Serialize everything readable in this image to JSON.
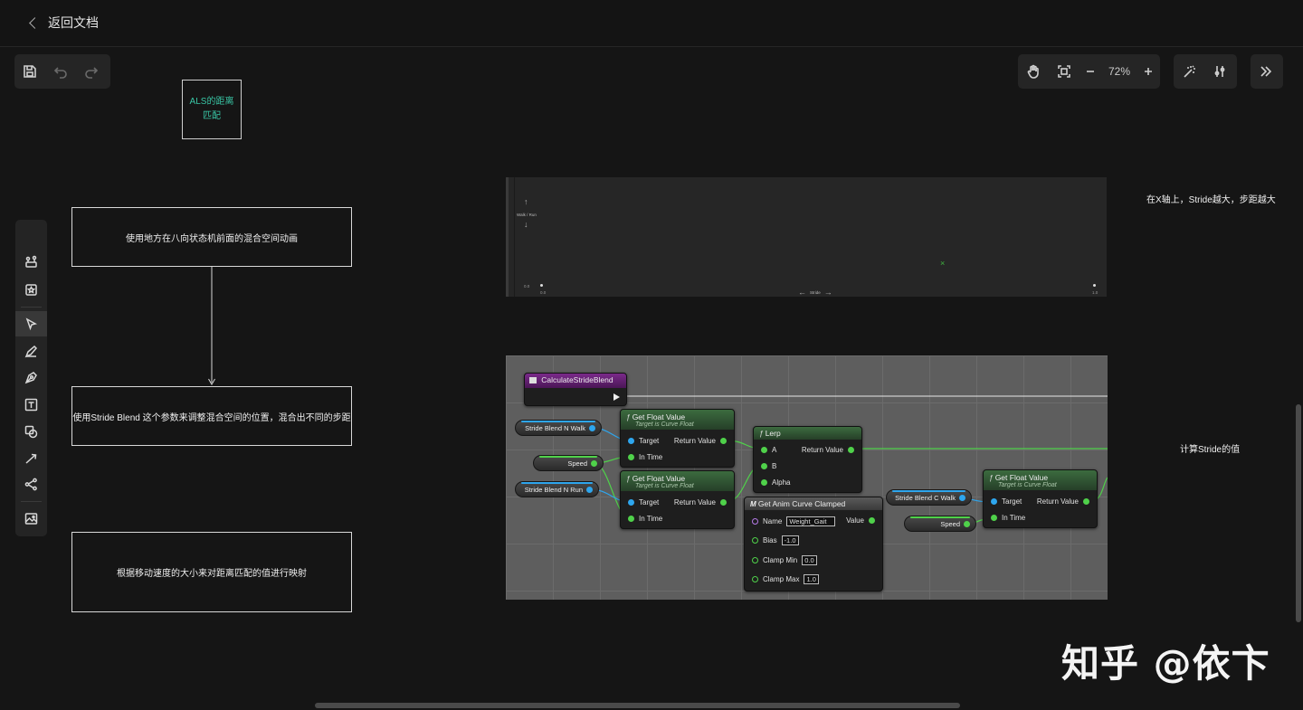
{
  "header": {
    "back_label": "返回文档"
  },
  "toolbar_left": {
    "save": "save-icon",
    "undo": "undo-icon",
    "redo": "redo-icon"
  },
  "toolbar_right": {
    "zoom": "72%"
  },
  "canvas": {
    "title_box": "ALS的距离匹配",
    "step1": "使用地方在八向状态机前面的混合空间动画",
    "step2": "使用Stride Blend 这个参数来调整混合空间的位置，混合出不同的步距",
    "step3": "根据移动速度的大小来对距离匹配的值进行映射",
    "note_top": "在X轴上，Stride越大，步距越大",
    "note_bottom": "计算Stride的值"
  },
  "blendspace": {
    "y_label": "Walk / Run",
    "x_label": "Stride",
    "x_min": "0.0",
    "x_max": "1.0",
    "y_min": "0.0"
  },
  "blueprint": {
    "entry": "CalculateStrideBlend",
    "var_walk": "Stride Blend N Walk",
    "var_speed": "Speed",
    "var_run": "Stride Blend N Run",
    "var_cwalk": "Stride Blend C Walk",
    "var_speed2": "Speed",
    "gfv_title": "Get Float Value",
    "gfv_sub": "Target is Curve Float",
    "target": "Target",
    "in_time": "In Time",
    "return_value": "Return Value",
    "lerp_title": "Lerp",
    "lerp_a": "A",
    "lerp_b": "B",
    "lerp_alpha": "Alpha",
    "clamp_title": "Get Anim Curve Clamped",
    "clamp_name": "Name",
    "clamp_name_val": "Weight_Gait",
    "clamp_value": "Value",
    "clamp_bias": "Bias",
    "clamp_bias_val": "-1.0",
    "clamp_min": "Clamp Min",
    "clamp_min_val": "0.0",
    "clamp_max": "Clamp Max",
    "clamp_max_val": "1.0"
  },
  "watermark": "知乎 @依卞"
}
